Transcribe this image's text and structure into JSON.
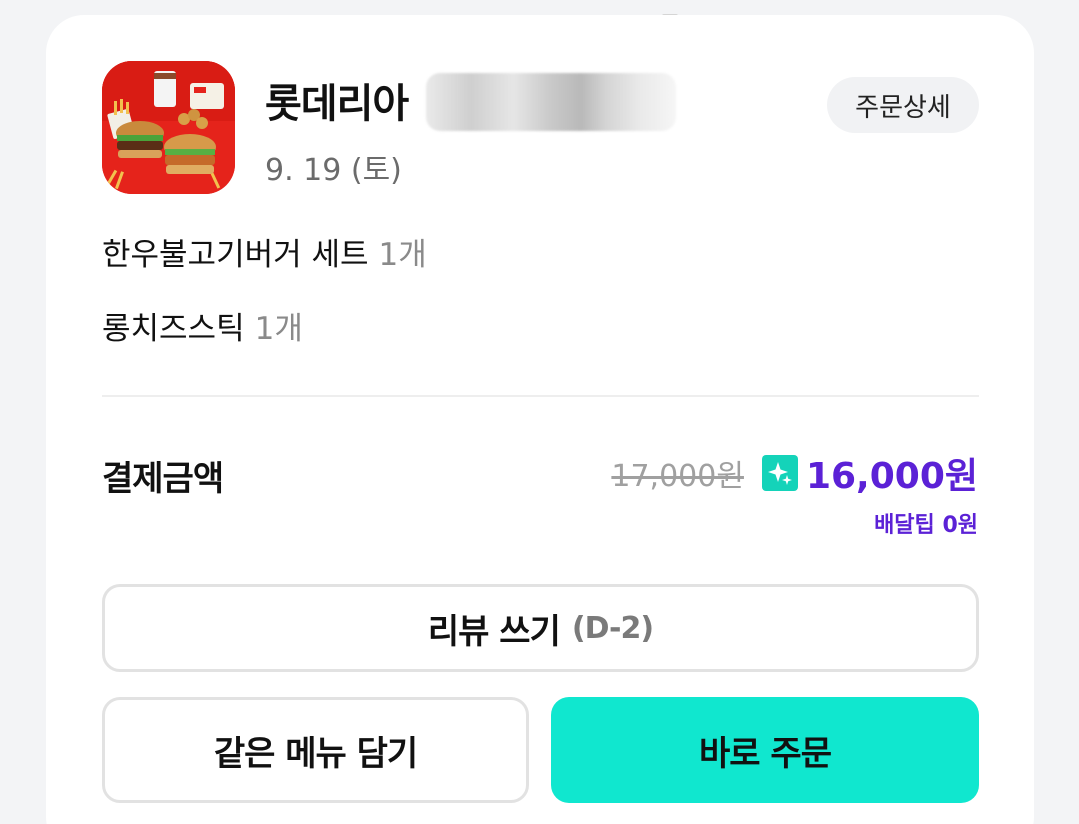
{
  "store": {
    "name": "롯데리아",
    "date": "9. 19 (토)",
    "detail_label": "주문상세"
  },
  "items": [
    {
      "name": "한우불고기버거 세트",
      "qty": "1개"
    },
    {
      "name": "롱치즈스틱",
      "qty": "1개"
    }
  ],
  "payment": {
    "label": "결제금액",
    "original_price": "17,000원",
    "final_price": "16,000원",
    "delivery_tip": "배달팁 0원"
  },
  "buttons": {
    "review": "리뷰 쓰기",
    "review_dday": "(D-2)",
    "same_menu": "같은 메뉴 담기",
    "order_now": "바로 주문"
  },
  "icons": {
    "store_logo": "lotteria-food-thumbnail",
    "discount": "sparkle-icon"
  },
  "colors": {
    "accent_purple": "#5b21d6",
    "mint": "#10e7cf",
    "sparkle_bg": "#14d3b9"
  }
}
